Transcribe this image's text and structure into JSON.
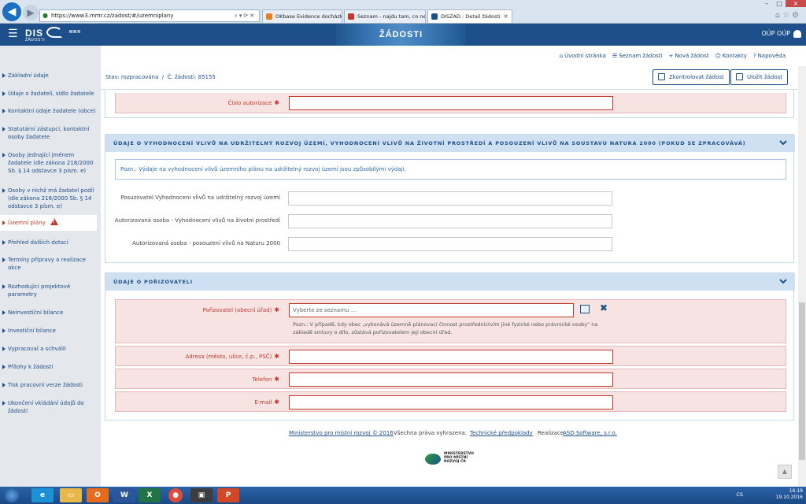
{
  "browser": {
    "url": "https://www3.mmr.cz/zadost/#/uzemniplany",
    "tabs": [
      {
        "label": "OKbase Evidence docházky",
        "active": false
      },
      {
        "label": "Seznam - najdu tam, co neznám",
        "active": false
      },
      {
        "label": "DISZAD : Detail žádosti",
        "active": true
      }
    ]
  },
  "appbar": {
    "logo_text": "DIS",
    "logo_sub": "ŽÁDOSTI",
    "logo_mmr": "MMR",
    "title": "ŽÁDOSTI",
    "user": "OÚP OÚP"
  },
  "toplinks": [
    {
      "icon": "home-icon",
      "glyph": "⌂",
      "label": "Úvodní stránka"
    },
    {
      "icon": "list-icon",
      "glyph": "☰",
      "label": "Seznam žádostí"
    },
    {
      "icon": "plus-icon",
      "glyph": "+",
      "label": "Nová žádost"
    },
    {
      "icon": "contacts-icon",
      "glyph": "☺",
      "label": "Kontakty"
    },
    {
      "icon": "help-icon",
      "glyph": "?",
      "label": "Nápověda"
    }
  ],
  "sidebar": [
    "Základní údaje",
    "Údaje o žadateli, sídlo žadatele",
    "Kontaktní údaje žadatele (obce)",
    "Statutární zástupci, kontaktní osoby žadatele",
    "Osoby jednající jménem žadatele (dle zákona 218/2000 Sb. § 14 odstavce 3 písm. e)",
    "Osoby v nichž má žadatel podíl (dle zákona 218/2000 Sb. § 14 odstavce 3 písm. e)",
    "Územní plány",
    "Přehled dalších dotací",
    "Termíny přípravy a realizace akce",
    "Rozhodující projektové parametry",
    "Neinvestiční bilance",
    "Investiční bilance",
    "Vypracoval a schválil",
    "Přílohy k žádosti",
    "Tisk pracovní verze žádosti",
    "Ukončení vkládání údajů do žádosti"
  ],
  "status": {
    "state": "Stav: rozpracována",
    "separator": "/",
    "number": "Č. žádosti: 85155"
  },
  "buttons": {
    "check": "Zkontrolovat žádost",
    "save": "Uložit žádost"
  },
  "section_top": {
    "field_label": "Číslo autorizace",
    "value": ""
  },
  "section_vliv": {
    "title": "ÚDAJE O VYHODNOCENÍ VLIVŮ NA UDRŽITELNÝ ROZVOJ ÚZEMÍ, VYHODNOCENÍ VLIVŮ NA ŽIVOTNÍ PROSTŘEDÍ A POSOUZENÍ VLIVŮ NA SOUSTAVU NATURA 2000 (POKUD SE ZPRACOVÁVÁ)",
    "note": "Pozn.: Výdaje na vyhodnocení vlivů územního plánu na udržitelný rozvoj území jsou způsobilými výdaji.",
    "fields": [
      {
        "label": "Posuzovatel Vyhodnocení vlivů na udržitelný rozvoj území",
        "value": ""
      },
      {
        "label": "Autorizovaná osoba - Vyhodnocení vlivů na životní prostředí",
        "value": ""
      },
      {
        "label": "Autorizovaná osoba - posouzení vlivů na Naturu 2000",
        "value": ""
      }
    ]
  },
  "section_poriz": {
    "title": "ÚDAJE O POŘIZOVATELI",
    "select_label": "Pořizovatel (obecní úřad)",
    "select_placeholder": "Vyberte ze seznamu ...",
    "hint": "Pozn.: V případě, kdy obec „vykonává územně plánovací činnost prostřednictvím jiné fyzické nebo právnické osoby\" na základě smluvy o dílo, zůstává pořizovatelem její obecní úřad.",
    "fields": [
      {
        "label": "Adresa (město, ulice, č.p., PSČ)",
        "value": ""
      },
      {
        "label": "Telefon",
        "value": ""
      },
      {
        "label": "E-mail",
        "value": ""
      }
    ]
  },
  "footer": {
    "ministry": "Ministerstvo pro místní rozvoj © 2016",
    "rights": "Všechna práva vyhrazena.",
    "tech": "Technické předpoklady",
    "realizace": "Realizace",
    "vendor": "ASD Software, s.r.o.",
    "logo_text": "MINISTERSTVO PRO MÍSTNÍ ROZVOJ ČR"
  },
  "taskbar": {
    "lang": "CS",
    "time": "16:19",
    "date": "19.10.2016"
  },
  "colors": {
    "brand": "#1d4f8a",
    "required_bg": "#f8e3e3",
    "error": "#c0392b",
    "section_head": "#cfe0f3"
  }
}
